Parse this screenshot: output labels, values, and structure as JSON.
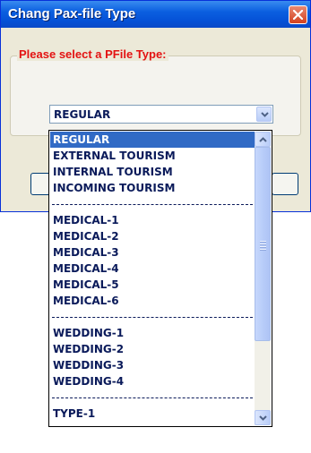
{
  "window": {
    "title": "Chang Pax-file Type"
  },
  "group": {
    "legend": "Please select a PFile Type:"
  },
  "combo": {
    "selected_value": "REGULAR"
  },
  "dropdown": {
    "items": [
      {
        "label": "REGULAR",
        "selected": true
      },
      {
        "label": "EXTERNAL TOURISM"
      },
      {
        "label": "INTERNAL TOURISM"
      },
      {
        "label": "INCOMING TOURISM"
      },
      {
        "separator": true
      },
      {
        "label": "MEDICAL-1"
      },
      {
        "label": "MEDICAL-2"
      },
      {
        "label": "MEDICAL-3"
      },
      {
        "label": "MEDICAL-4"
      },
      {
        "label": "MEDICAL-5"
      },
      {
        "label": "MEDICAL-6"
      },
      {
        "separator": true
      },
      {
        "label": "WEDDING-1"
      },
      {
        "label": "WEDDING-2"
      },
      {
        "label": "WEDDING-3"
      },
      {
        "label": "WEDDING-4"
      },
      {
        "separator": true
      },
      {
        "label": "TYPE-1"
      }
    ]
  },
  "colors": {
    "title_bar": "#0b5fe0",
    "legend_text": "#e31212",
    "selection": "#316ac5",
    "item_text": "#0a1a5a"
  },
  "icons": {
    "close": "close-icon",
    "combo_arrow": "chevron-down-icon",
    "scroll_up": "chevron-up-icon",
    "scroll_down": "chevron-down-icon"
  }
}
